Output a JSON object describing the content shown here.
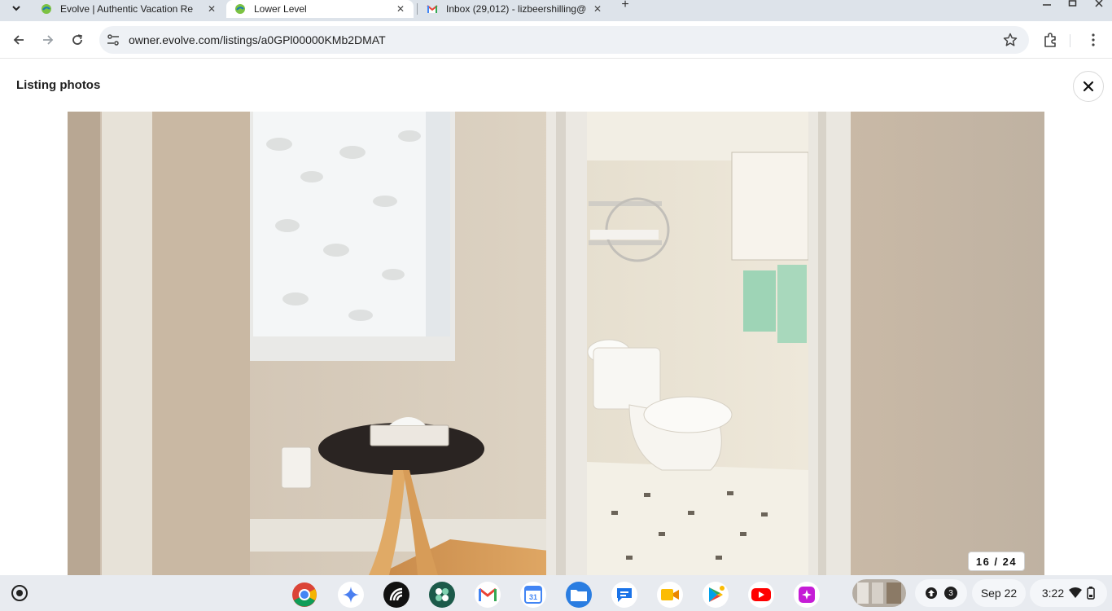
{
  "browser": {
    "tabs": [
      {
        "title": "Evolve | Authentic Vacation Re",
        "active": false
      },
      {
        "title": "Lower Level",
        "active": true
      },
      {
        "title": "Inbox (29,012) - lizbeershilling@",
        "active": false
      }
    ],
    "url": "owner.evolve.com/listings/a0GPl00000KMb2DMAT"
  },
  "page": {
    "title": "Listing photos",
    "photo_counter": "16 / 24"
  },
  "shelf": {
    "apps": [
      "chrome-icon",
      "assistant-icon",
      "app-icon",
      "app-icon",
      "gmail-icon",
      "calendar-icon",
      "files-icon",
      "messages-icon",
      "meet-icon",
      "play-store-icon",
      "youtube-icon",
      "app-icon"
    ],
    "calendar_day": "31",
    "notification_count": "3",
    "date": "Sep 22",
    "time": "3:22"
  },
  "colors": {
    "tab_strip": "#dde3ea",
    "omnibox": "#eef1f5",
    "shelf": "#e8ebf0"
  }
}
